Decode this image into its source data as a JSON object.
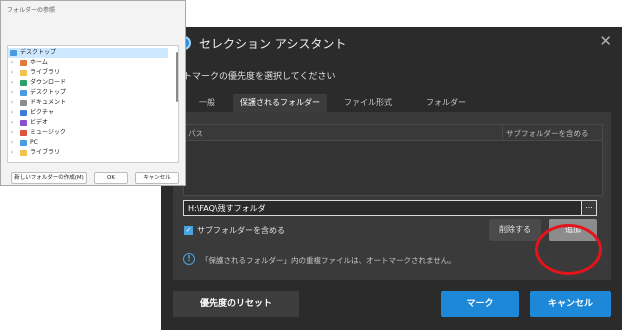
{
  "folder_dialog": {
    "title": "フォルダーの参照",
    "tree": [
      {
        "label": "デスクトップ",
        "icon": "desktop-folder-icon",
        "color": "#4a9be0",
        "level": 0,
        "selected": true
      },
      {
        "label": "ホーム",
        "icon": "home-icon",
        "color": "#e07b39",
        "level": 1
      },
      {
        "label": "ライブラリ",
        "icon": "folder-icon",
        "color": "#f2c14e",
        "level": 1
      },
      {
        "label": "ダウンロード",
        "icon": "download-icon",
        "color": "#2e9e6a",
        "level": 1
      },
      {
        "label": "デスクトップ",
        "icon": "desktop-folder-icon",
        "color": "#4a9be0",
        "level": 1
      },
      {
        "label": "ドキュメント",
        "icon": "document-icon",
        "color": "#8c8c8c",
        "level": 1
      },
      {
        "label": "ピクチャ",
        "icon": "picture-icon",
        "color": "#3d7bd9",
        "level": 1
      },
      {
        "label": "ビデオ",
        "icon": "video-icon",
        "color": "#8a4fd1",
        "level": 1
      },
      {
        "label": "ミュージック",
        "icon": "music-icon",
        "color": "#e0533c",
        "level": 1
      },
      {
        "label": "PC",
        "icon": "pc-icon",
        "color": "#4a9be0",
        "level": 1
      },
      {
        "label": "ライブラリ",
        "icon": "folder-icon",
        "color": "#f2c14e",
        "level": 1
      }
    ],
    "buttons": {
      "new_folder": "新しいフォルダーの作成(M)",
      "ok": "OK",
      "cancel": "キャンセル"
    }
  },
  "main_dialog": {
    "title": "セレクション アシスタント",
    "instruction": "トマークの優先度を選択してください",
    "tabs": [
      "一般",
      "保護されるフォルダー",
      "ファイル形式",
      "フォルダー"
    ],
    "active_tab": "保護されるフォルダー",
    "grid": {
      "col_path": "パス",
      "col_include": "サブフォルダーを含める"
    },
    "path_value": "H:\\FAQ\\残すフォルダ",
    "browse_label": "...",
    "include_subfolders_label": "サブフォルダーを含める",
    "include_subfolders_checked": true,
    "delete_label": "削除する",
    "add_label": "追加",
    "info": "「保護されるフォルダー」内の重複ファイルは、オートマークされません。",
    "reset_label": "優先度のリセット",
    "mark_label": "マーク",
    "cancel_label": "キャンセル",
    "accent_color": "#1e88d8",
    "highlight_color": "#e3151b"
  }
}
